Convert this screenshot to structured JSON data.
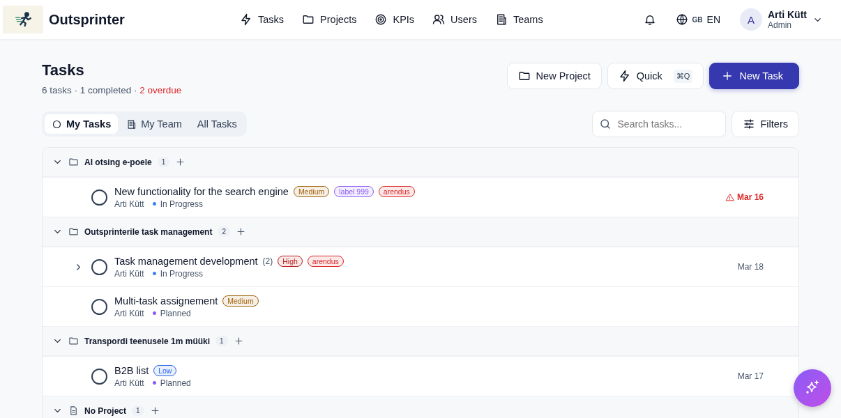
{
  "brand": {
    "name": "Outsprinter"
  },
  "nav": [
    {
      "label": "Tasks",
      "kind": "bolt"
    },
    {
      "label": "Projects",
      "kind": "folder"
    },
    {
      "label": "KPIs",
      "kind": "target"
    },
    {
      "label": "Users",
      "kind": "users"
    },
    {
      "label": "Teams",
      "kind": "building"
    }
  ],
  "language": {
    "flag": "GB",
    "code": "EN"
  },
  "user": {
    "initial": "A",
    "name": "Arti Kütt",
    "role": "Admin"
  },
  "page": {
    "title": "Tasks",
    "summary": "6 tasks · 1 completed ·",
    "overdue": "2 overdue"
  },
  "actions": [
    {
      "label": "New Project",
      "kind": "folder"
    },
    {
      "label": "Quick",
      "kind": "quick",
      "shortcut": "⌘Q"
    },
    {
      "label": "New Task",
      "kind": "primary"
    }
  ],
  "tabs": [
    {
      "label": "My Tasks",
      "kind": "circle",
      "selected": true
    },
    {
      "label": "My Team",
      "kind": "building",
      "selected": false
    },
    {
      "label": "All Tasks",
      "selected": false
    }
  ],
  "search": {
    "placeholder": "Search tasks..."
  },
  "filters": {
    "label": "Filters"
  },
  "groups": [
    {
      "name": "AI otsing e-poele",
      "kind": "project",
      "count": "1",
      "expanded": true,
      "tasks": [
        {
          "title": "New functionality for the search engine",
          "checked": false,
          "tags": [
            {
              "label": "Medium",
              "color": "#a16207"
            },
            {
              "label": "label 999",
              "color": "#8b5cf6"
            },
            {
              "label": "arendus",
              "color": "#dc2626"
            }
          ],
          "assignee": "Arti Kütt",
          "status": {
            "label": "In Progress",
            "color": "#3b82f6"
          },
          "due": "Mar 16",
          "overdue": true
        }
      ]
    },
    {
      "name": "Outsprinterile task management",
      "kind": "project",
      "count": "2",
      "expanded": true,
      "tasks": [
        {
          "title": "Task management development",
          "subtasks": "(2)",
          "expanded": false,
          "checked": false,
          "tags": [
            {
              "label": "High",
              "color": "#b91c1c"
            },
            {
              "label": "arendus",
              "color": "#dc2626"
            }
          ],
          "assignee": "Arti Kütt",
          "status": {
            "label": "In Progress",
            "color": "#3b82f6"
          },
          "due": "Mar 18",
          "overdue": false
        },
        {
          "title": "Multi-task assignement",
          "checked": false,
          "tags": [
            {
              "label": "Medium",
              "color": "#a16207"
            }
          ],
          "assignee": "Arti Kütt",
          "status": {
            "label": "Planned",
            "color": "#8b5cf6"
          }
        }
      ]
    },
    {
      "name": "Transpordi teenusele 1m müüki",
      "kind": "project",
      "count": "1",
      "expanded": true,
      "tasks": [
        {
          "title": "B2B list",
          "checked": false,
          "tags": [
            {
              "label": "Low",
              "color": "#2563eb"
            }
          ],
          "assignee": "Arti Kütt",
          "status": {
            "label": "Planned",
            "color": "#8b5cf6"
          },
          "due": "Mar 17",
          "overdue": false
        }
      ]
    },
    {
      "name": "No Project",
      "kind": "none",
      "count": "1",
      "expanded": true
    }
  ]
}
